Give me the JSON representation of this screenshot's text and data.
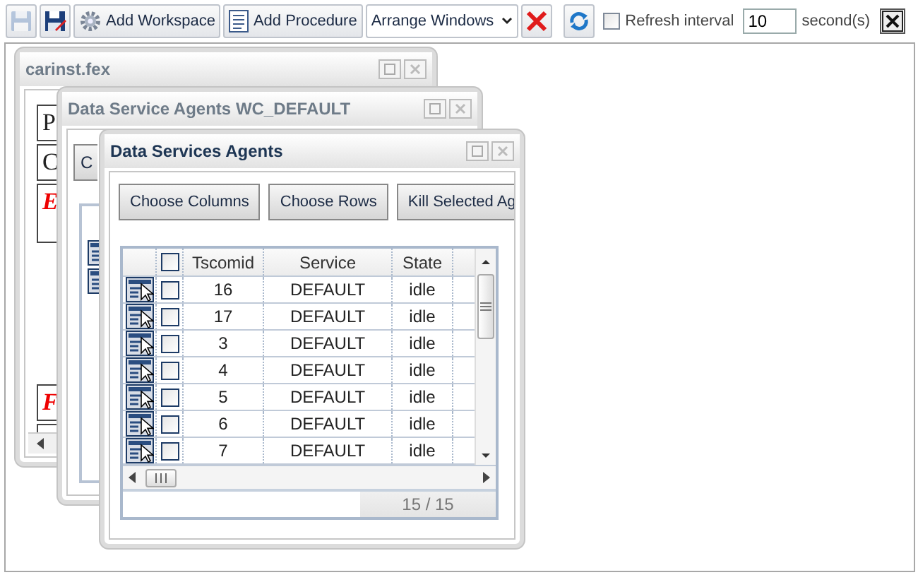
{
  "toolbar": {
    "save_disabled": true,
    "add_workspace": "Add Workspace",
    "add_procedure": "Add Procedure",
    "arrange": "Arrange Windows",
    "refresh_checked": false,
    "refresh_label": "Refresh interval",
    "interval": "10",
    "unit": "second(s)"
  },
  "report_window": {
    "title": "carinst.fex",
    "cells": [
      {
        "text": "P",
        "kind": "plain"
      },
      {
        "text": "C",
        "kind": "plain"
      },
      {
        "text": "E",
        "kind": "emphasis"
      },
      {
        "text": "F",
        "kind": "emphasis"
      }
    ]
  },
  "wc_window": {
    "title": "Data Service Agents WC_DEFAULT",
    "button": "C"
  },
  "agents_window": {
    "title": "Data Services Agents",
    "buttons": [
      "Choose Columns",
      "Choose Rows",
      "Kill Selected Ag"
    ],
    "table": {
      "columns": [
        "Tscomid",
        "Service",
        "State"
      ],
      "header_checked": false,
      "rows": [
        {
          "tscomid": "16",
          "service": "DEFAULT",
          "state": "idle",
          "checked": false
        },
        {
          "tscomid": "17",
          "service": "DEFAULT",
          "state": "idle",
          "checked": false
        },
        {
          "tscomid": "3",
          "service": "DEFAULT",
          "state": "idle",
          "checked": false
        },
        {
          "tscomid": "4",
          "service": "DEFAULT",
          "state": "idle",
          "checked": false
        },
        {
          "tscomid": "5",
          "service": "DEFAULT",
          "state": "idle",
          "checked": false
        },
        {
          "tscomid": "6",
          "service": "DEFAULT",
          "state": "idle",
          "checked": false
        },
        {
          "tscomid": "7",
          "service": "DEFAULT",
          "state": "idle",
          "checked": false
        }
      ],
      "pager": "15 / 15"
    }
  }
}
